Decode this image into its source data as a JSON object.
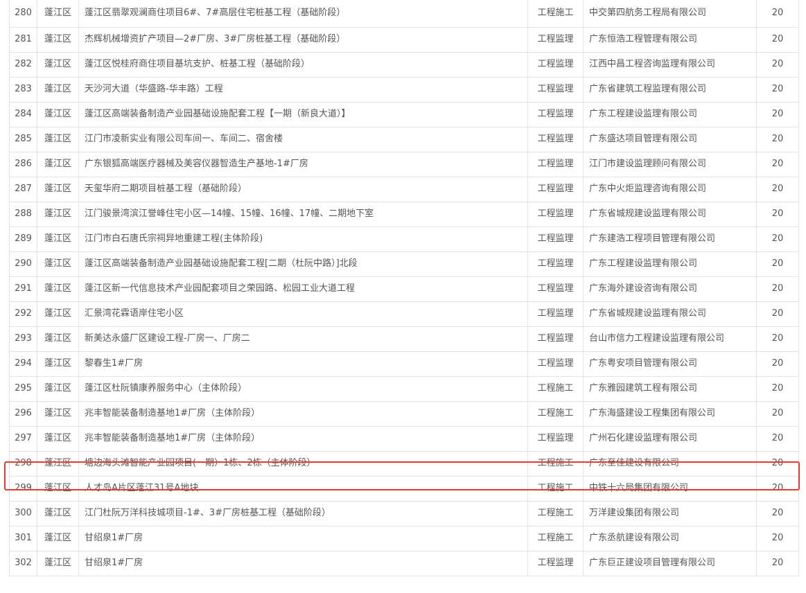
{
  "rows": [
    {
      "no": "280",
      "district": "蓬江区",
      "project": "蓬江区翡翠观澜商住项目6#、7#高层住宅桩基工程（基础阶段）",
      "type": "工程施工",
      "company": "中交第四航务工程局有限公司",
      "score": "20"
    },
    {
      "no": "281",
      "district": "蓬江区",
      "project": "杰辉机械增资扩产项目—2#厂房、3#厂房桩基工程（基础阶段）",
      "type": "工程监理",
      "company": "广东恒浩工程管理有限公司",
      "score": "20"
    },
    {
      "no": "282",
      "district": "蓬江区",
      "project": "蓬江区悦桂府商住项目基坑支护、桩基工程（基础阶段）",
      "type": "工程监理",
      "company": "江西中昌工程咨询监理有限公司",
      "score": "20"
    },
    {
      "no": "283",
      "district": "蓬江区",
      "project": "天沙河大道（华盛路-华丰路）工程",
      "type": "工程监理",
      "company": "广东省建筑工程监理有限公司",
      "score": "20"
    },
    {
      "no": "284",
      "district": "蓬江区",
      "project": "蓬江区高端装备制造产业园基础设施配套工程【一期（新良大道）】",
      "type": "工程监理",
      "company": "广东工程建设监理有限公司",
      "score": "20"
    },
    {
      "no": "285",
      "district": "蓬江区",
      "project": "江门市凌新实业有限公司车间一、车间二、宿舍楼",
      "type": "工程监理",
      "company": "广东盛达项目管理有限公司",
      "score": "20"
    },
    {
      "no": "286",
      "district": "蓬江区",
      "project": "广东银狐高端医疗器械及美容仪器智造生产基地-1#厂房",
      "type": "工程监理",
      "company": "江门市建设监理顾问有限公司",
      "score": "20"
    },
    {
      "no": "287",
      "district": "蓬江区",
      "project": "天玺华府二期项目桩基工程（基础阶段）",
      "type": "工程监理",
      "company": "广东中火炬监理咨询有限公司",
      "score": "20"
    },
    {
      "no": "288",
      "district": "蓬江区",
      "project": "江门骏景湾滨江誉峰住宅小区—14幢、15幢、16幢、17幢、二期地下室",
      "type": "工程监理",
      "company": "广东省城规建设监理有限公司",
      "score": "20"
    },
    {
      "no": "289",
      "district": "蓬江区",
      "project": "江门市白石唐氏宗祠异地重建工程(主体阶段)",
      "type": "工程监理",
      "company": "广东建浩工程项目管理有限公司",
      "score": "20"
    },
    {
      "no": "290",
      "district": "蓬江区",
      "project": "蓬江区高端装备制造产业园基础设施配套工程[二期（杜阮中路）]北段",
      "type": "工程监理",
      "company": "广东工程建设监理有限公司",
      "score": "20"
    },
    {
      "no": "291",
      "district": "蓬江区",
      "project": "蓬江区新一代信息技术产业园配套项目之荣园路、松园工业大道工程",
      "type": "工程监理",
      "company": "广东海外建设咨询有限公司",
      "score": "20"
    },
    {
      "no": "292",
      "district": "蓬江区",
      "project": "汇景湾花霖语岸住宅小区",
      "type": "工程监理",
      "company": "广东省城规建设监理有限公司",
      "score": "20"
    },
    {
      "no": "293",
      "district": "蓬江区",
      "project": "新美达永盛厂区建设工程-厂房一、厂房二",
      "type": "工程监理",
      "company": "台山市信力工程建设监理有限公司",
      "score": "20"
    },
    {
      "no": "294",
      "district": "蓬江区",
      "project": "黎春生1#厂房",
      "type": "工程监理",
      "company": "广东粤安项目管理有限公司",
      "score": "20"
    },
    {
      "no": "295",
      "district": "蓬江区",
      "project": "蓬江区杜阮镇康养服务中心（主体阶段）",
      "type": "工程施工",
      "company": "广东雅园建筑工程有限公司",
      "score": "20"
    },
    {
      "no": "296",
      "district": "蓬江区",
      "project": "兆丰智能装备制造基地1#厂房（主体阶段）",
      "type": "工程施工",
      "company": "广东海盛建设工程集团有限公司",
      "score": "20"
    },
    {
      "no": "297",
      "district": "蓬江区",
      "project": "兆丰智能装备制造基地1#厂房（主体阶段）",
      "type": "工程监理",
      "company": "广州石化建设监理有限公司",
      "score": "20"
    },
    {
      "no": "298",
      "district": "蓬江区",
      "project": "塘边海头滩智能产业园项目(一期）1栋、2栋（主体阶段）",
      "type": "工程施工",
      "company": "广东至佳建设有限公司",
      "score": "20",
      "highlighted": true
    },
    {
      "no": "299",
      "district": "蓬江区",
      "project": "人才岛A片区蓬江31号A地块",
      "type": "工程施工",
      "company": "中铁十六局集团有限公司",
      "score": "20"
    },
    {
      "no": "300",
      "district": "蓬江区",
      "project": "江门杜阮万洋科技城项目-1#、3#厂房桩基工程（基础阶段）",
      "type": "工程施工",
      "company": "万洋建设集团有限公司",
      "score": "20"
    },
    {
      "no": "301",
      "district": "蓬江区",
      "project": "甘绍泉1#厂房",
      "type": "工程施工",
      "company": "广东丞航建设有限公司",
      "score": "20"
    },
    {
      "no": "302",
      "district": "蓬江区",
      "project": "甘绍泉1#厂房",
      "type": "工程监理",
      "company": "广东巨正建设项目管理有限公司",
      "score": "20"
    }
  ],
  "colors": {
    "text": "#555555",
    "border": "#e2e2e2",
    "highlight": "#e33a33"
  }
}
